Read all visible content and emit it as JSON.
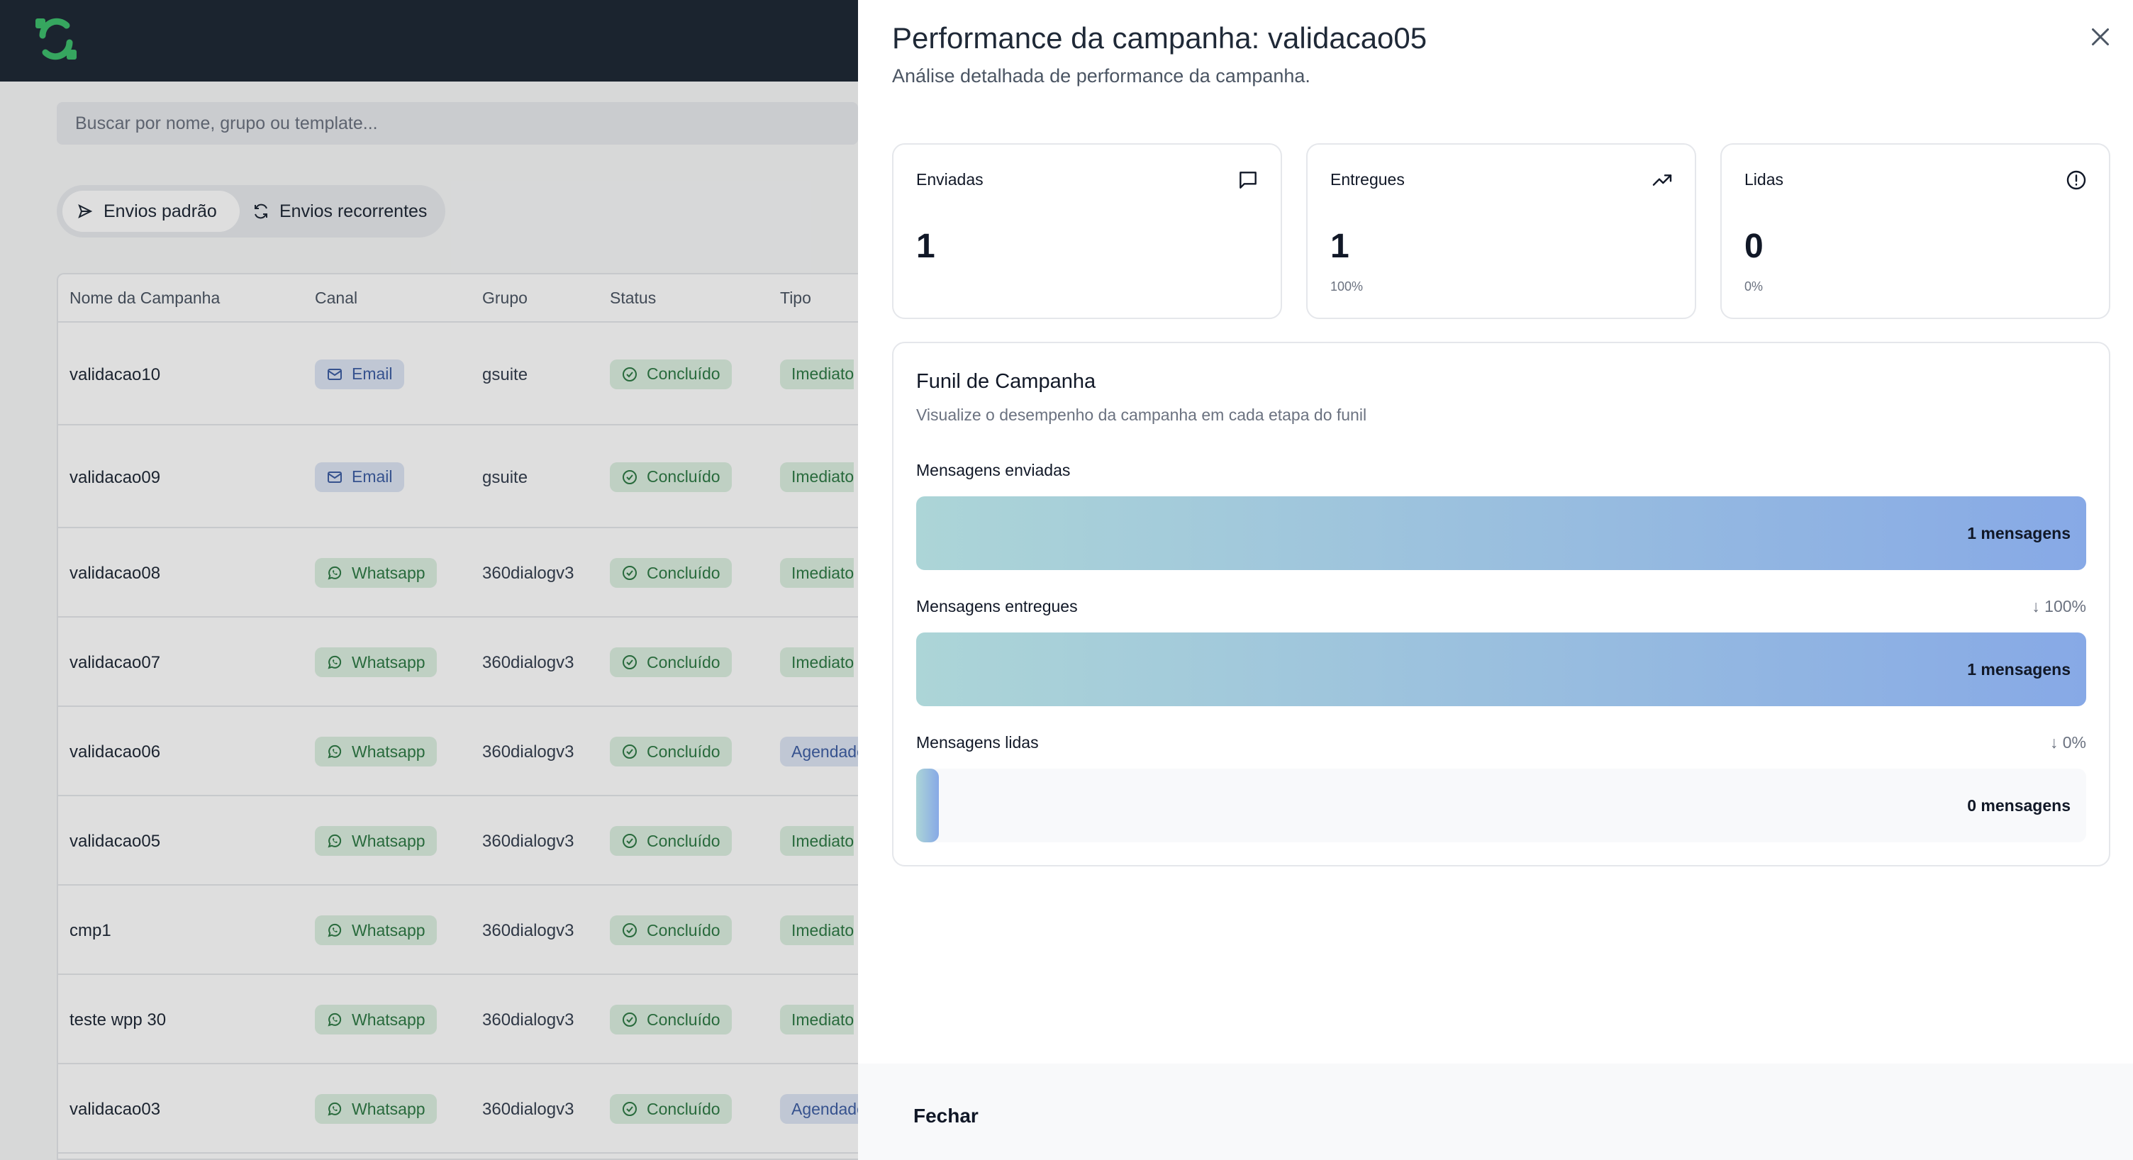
{
  "background": {
    "search_placeholder": "Buscar por nome, grupo ou template...",
    "tabs": {
      "standard": "Envios padrão",
      "recurring": "Envios recorrentes"
    },
    "columns": [
      "Nome da Campanha",
      "Canal",
      "Grupo",
      "Status",
      "Tipo"
    ],
    "rows": [
      {
        "name": "validacao10",
        "channel": "Email",
        "group": "gsuite",
        "status": "Concluído",
        "type": "Imediato"
      },
      {
        "name": "validacao09",
        "channel": "Email",
        "group": "gsuite",
        "status": "Concluído",
        "type": "Imediato"
      },
      {
        "name": "validacao08",
        "channel": "Whatsapp",
        "group": "360dialogv3",
        "status": "Concluído",
        "type": "Imediato"
      },
      {
        "name": "validacao07",
        "channel": "Whatsapp",
        "group": "360dialogv3",
        "status": "Concluído",
        "type": "Imediato"
      },
      {
        "name": "validacao06",
        "channel": "Whatsapp",
        "group": "360dialogv3",
        "status": "Concluído",
        "type": "Agendado"
      },
      {
        "name": "validacao05",
        "channel": "Whatsapp",
        "group": "360dialogv3",
        "status": "Concluído",
        "type": "Imediato"
      },
      {
        "name": "cmp1",
        "channel": "Whatsapp",
        "group": "360dialogv3",
        "status": "Concluído",
        "type": "Imediato"
      },
      {
        "name": "teste wpp 30",
        "channel": "Whatsapp",
        "group": "360dialogv3",
        "status": "Concluído",
        "type": "Imediato"
      },
      {
        "name": "validacao03",
        "channel": "Whatsapp",
        "group": "360dialogv3",
        "status": "Concluído",
        "type": "Agendado"
      }
    ]
  },
  "panel": {
    "title": "Performance da campanha: validacao05",
    "subtitle": "Análise detalhada de performance da campanha.",
    "stats": [
      {
        "label": "Enviadas",
        "value": "1",
        "percent": "",
        "icon": "message-square-icon"
      },
      {
        "label": "Entregues",
        "value": "1",
        "percent": "100%",
        "icon": "trending-up-icon"
      },
      {
        "label": "Lidas",
        "value": "0",
        "percent": "0%",
        "icon": "alert-circle-icon"
      }
    ],
    "funnel": {
      "title": "Funil de Campanha",
      "subtitle": "Visualize o desempenho da campanha em cada etapa do funil",
      "stages": [
        {
          "label": "Mensagens enviadas",
          "count": "1 mensagens",
          "delta": "",
          "fill": 1.0
        },
        {
          "label": "Mensagens entregues",
          "count": "1 mensagens",
          "delta": "↓ 100%",
          "fill": 1.0
        },
        {
          "label": "Mensagens lidas",
          "count": "0 mensagens",
          "delta": "↓ 0%",
          "fill": 0.0
        }
      ]
    },
    "footer_button": "Fechar"
  },
  "colors": {
    "topbar": "#1f2a37",
    "brand_green": "#3fbf6e",
    "funnel_gradient_start": "#acd5d7",
    "funnel_gradient_end": "#87a9e6"
  }
}
